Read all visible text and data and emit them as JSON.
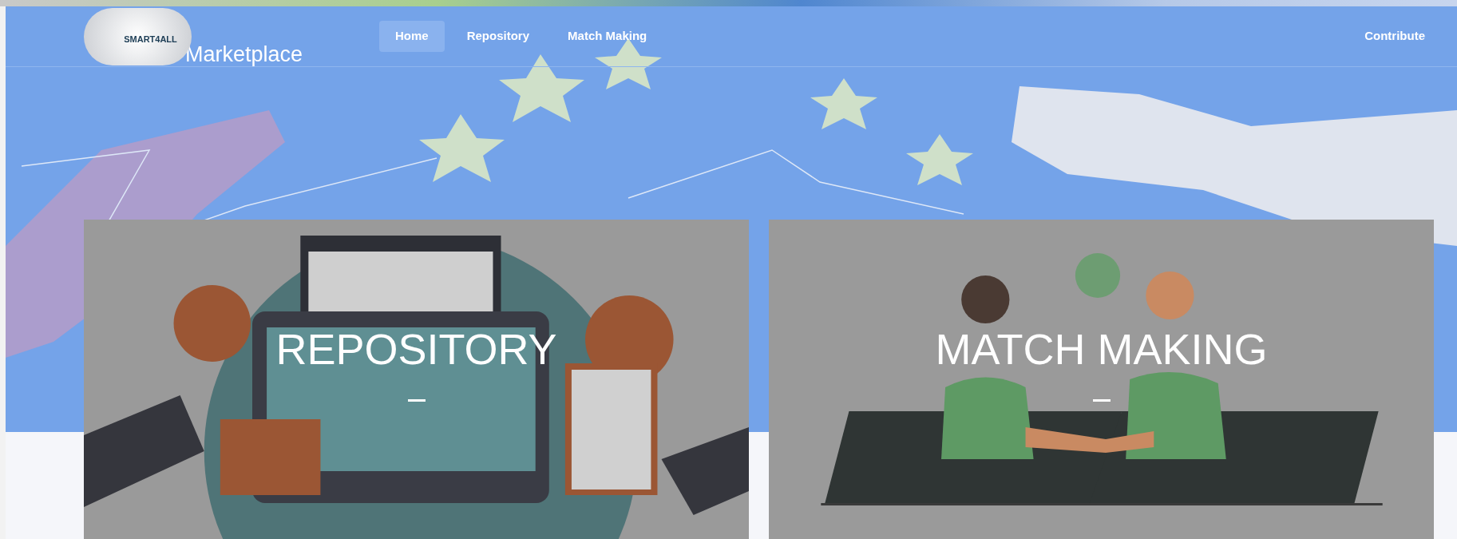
{
  "logo": {
    "text": "SMART4ALL",
    "subtitle": "Marketplace"
  },
  "nav": [
    {
      "label": "Home",
      "selected": true
    },
    {
      "label": "Repository",
      "selected": false
    },
    {
      "label": "Match Making",
      "selected": false
    }
  ],
  "nav_right": {
    "label": "Contribute"
  },
  "cards": [
    {
      "title": "REPOSITORY",
      "kind": "repository"
    },
    {
      "title": "MATCH MAKING",
      "kind": "matchmaking"
    }
  ]
}
